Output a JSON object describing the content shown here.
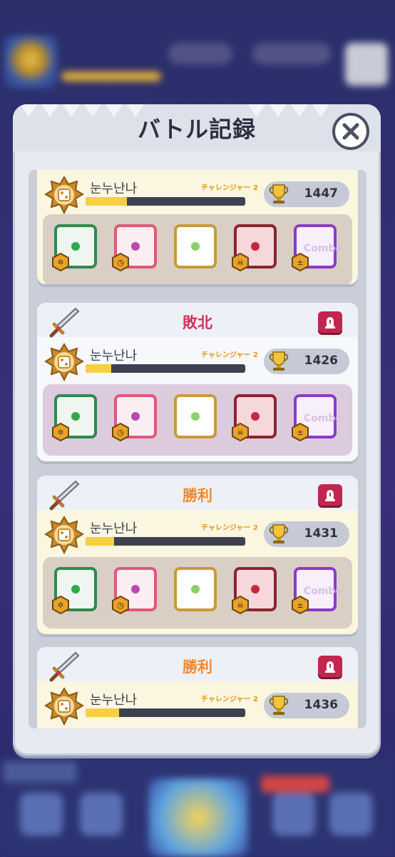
{
  "modal": {
    "title": "バトル記録"
  },
  "icons": {
    "close": "close-icon",
    "sword": "sword-icon",
    "report": "report-icon",
    "trophy": "trophy-icon",
    "emblem": "rank-emblem-icon"
  },
  "colors": {
    "win_text": "#f08a2c",
    "lose_text": "#d0335c",
    "xp_fill": "#f7cf45",
    "rank_text": "#e59820"
  },
  "battles": [
    {
      "result": "",
      "player": {
        "name": "눈누난나",
        "rank": "チャレンジャー 2",
        "trophies": "1447",
        "xp_fraction": 0.26
      },
      "deck": [
        {
          "die": "green",
          "badge": "star-badge"
        },
        {
          "die": "pink",
          "badge": "clock-badge"
        },
        {
          "die": "rainbow",
          "badge": ""
        },
        {
          "die": "red",
          "badge": "skull-badge"
        },
        {
          "die": "purple-combo",
          "badge": "plus-minus-badge",
          "label": "Combo"
        }
      ]
    },
    {
      "result": "敗北",
      "player": {
        "name": "눈누난나",
        "rank": "チャレンジャー 2",
        "trophies": "1426",
        "xp_fraction": 0.16
      },
      "deck": [
        {
          "die": "green",
          "badge": "star-badge"
        },
        {
          "die": "pink",
          "badge": "clock-badge"
        },
        {
          "die": "rainbow",
          "badge": ""
        },
        {
          "die": "red",
          "badge": "skull-badge"
        },
        {
          "die": "purple-combo",
          "badge": "plus-minus-badge",
          "label": "Combo"
        }
      ]
    },
    {
      "result": "勝利",
      "player": {
        "name": "눈누난나",
        "rank": "チャレンジャー 2",
        "trophies": "1431",
        "xp_fraction": 0.18
      },
      "deck": [
        {
          "die": "green",
          "badge": "star-badge"
        },
        {
          "die": "pink",
          "badge": "clock-badge"
        },
        {
          "die": "rainbow",
          "badge": ""
        },
        {
          "die": "red",
          "badge": "skull-badge"
        },
        {
          "die": "purple-combo",
          "badge": "plus-minus-badge",
          "label": "Combo"
        }
      ]
    },
    {
      "result": "勝利",
      "player": {
        "name": "눈누난나",
        "rank": "チャレンジャー 2",
        "trophies": "1436",
        "xp_fraction": 0.21
      }
    }
  ]
}
